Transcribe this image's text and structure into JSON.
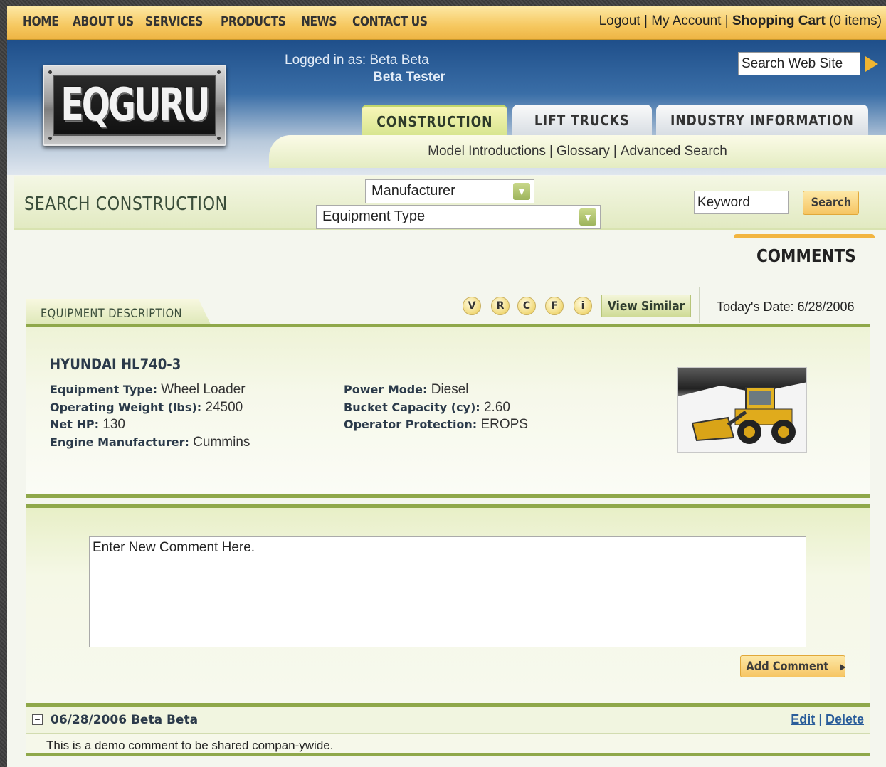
{
  "nav": {
    "items": [
      "HOME",
      "ABOUT US",
      "SERVICES",
      "PRODUCTS",
      "NEWS",
      "CONTACT US"
    ],
    "logout": "Logout",
    "my_account": "My Account",
    "cart_label": "Shopping Cart",
    "cart_count": "(0 items)",
    "sep": "|"
  },
  "header": {
    "logo_text": "EQGURU",
    "logged_in_as": "Logged in as: Beta Beta",
    "user_role": "Beta Tester",
    "site_search_value": "Search Web Site",
    "tabs": [
      "CONSTRUCTION",
      "LIFT TRUCKS",
      "INDUSTRY INFORMATION"
    ],
    "subnav": [
      "Model Introductions",
      "Glossary",
      "Advanced Search"
    ]
  },
  "search": {
    "title": "SEARCH CONSTRUCTION",
    "manufacturer": "Manufacturer",
    "equipment_type": "Equipment Type",
    "keyword_value": "Keyword",
    "button": "Search"
  },
  "comments_title": "COMMENTS",
  "toolbar": {
    "tab_label": "EQUIPMENT DESCRIPTION",
    "circles": [
      "V",
      "R",
      "C",
      "F",
      "i"
    ],
    "view_similar": "View Similar",
    "todays_date": "Today's Date: 6/28/2006"
  },
  "equipment": {
    "name": "HYUNDAI HL740-3",
    "specs_left": [
      {
        "label": "Equipment Type:",
        "value": "Wheel Loader"
      },
      {
        "label": "Operating Weight (lbs):",
        "value": "24500"
      },
      {
        "label": "Net HP:",
        "value": "130"
      },
      {
        "label": "Engine Manufacturer:",
        "value": "Cummins"
      }
    ],
    "specs_right": [
      {
        "label": "Power Mode:",
        "value": "Diesel"
      },
      {
        "label": "Bucket Capacity (cy):",
        "value": "2.60"
      },
      {
        "label": "Operator Protection:",
        "value": "EROPS"
      }
    ]
  },
  "comment_form": {
    "placeholder": "Enter New Comment Here.",
    "button": "Add Comment"
  },
  "comment": {
    "meta": "06/28/2006 Beta Beta",
    "edit": "Edit",
    "delete": "Delete",
    "sep": "|",
    "body": "This is a demo comment to be shared compan-ywide."
  },
  "colors": {
    "nav_bg": "#f6c860",
    "header_blue": "#1f4f8a",
    "panel_green": "#8fa84a",
    "button_orange": "#f6c563",
    "link_blue": "#2a5d9a"
  }
}
